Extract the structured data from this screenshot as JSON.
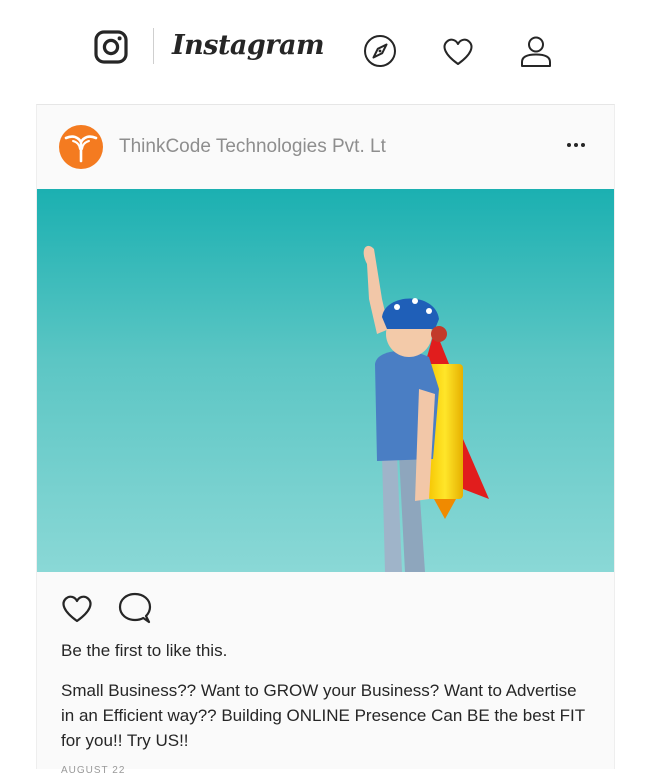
{
  "nav": {
    "brand": "Instagram",
    "icons": [
      "instagram-logo-icon",
      "compass-icon",
      "heart-icon",
      "profile-icon"
    ]
  },
  "post": {
    "author": "ThinkCode Technologies Pvt. Lt",
    "likes_text": "Be the first to like this.",
    "caption": "Small Business?? Want to GROW your Business? Want to Advertise in an Efficient way?? Building ONLINE Presence Can BE the best FIT for you!! Try US!!",
    "timestamp": "AUGUST 22",
    "accent_color": "#f47b20",
    "icons": [
      "more-options-icon",
      "like-heart-icon",
      "comment-icon"
    ]
  }
}
